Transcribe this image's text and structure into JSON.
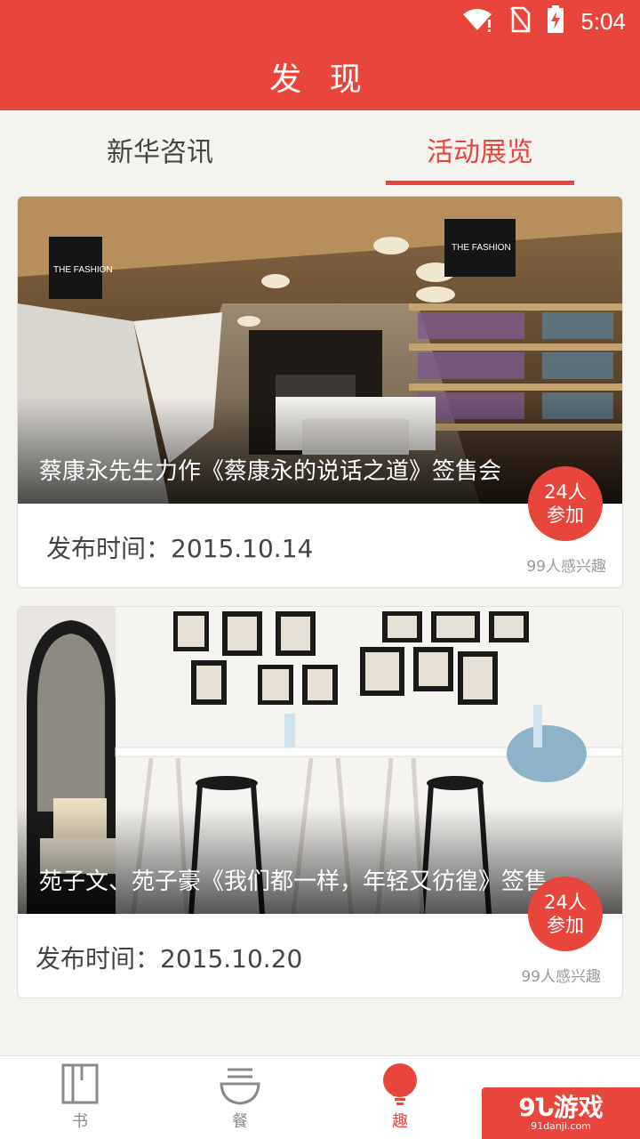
{
  "status_bar": {
    "time": "5:04"
  },
  "header": {
    "title": "发 现"
  },
  "tabs": [
    {
      "label": "新华咨讯",
      "active": false
    },
    {
      "label": "活动展览",
      "active": true
    }
  ],
  "cards": [
    {
      "title": "蔡康永先生力作《蔡康永的说话之道》签售会",
      "badge_line1": "24人",
      "badge_line2": "参加",
      "date": "发布时间：2015.10.14",
      "interest": "99人感兴趣"
    },
    {
      "title": "苑子文、苑子豪《我们都一样，年轻又彷徨》签售",
      "badge_line1": "24人",
      "badge_line2": "参加",
      "date": "发布时间：2015.10.20",
      "interest": "99人感兴趣"
    }
  ],
  "nav": [
    {
      "label": "书",
      "icon": "book-icon"
    },
    {
      "label": "餐",
      "icon": "bowl-icon"
    },
    {
      "label": "趣",
      "icon": "bulb-icon",
      "active": true
    },
    {
      "label": "",
      "icon": "search-icon"
    }
  ],
  "watermark": {
    "main": "9Ն游戏",
    "sub": "91danji.com"
  },
  "colors": {
    "accent": "#e8453c",
    "background": "#f5f3ee"
  }
}
